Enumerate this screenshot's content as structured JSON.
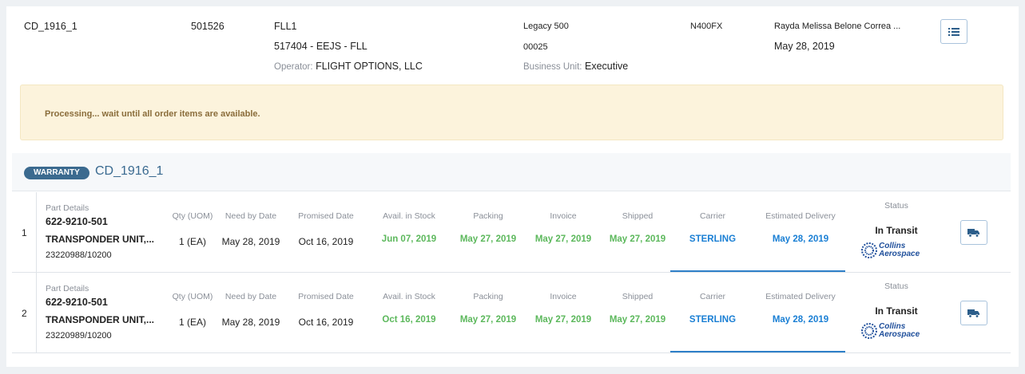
{
  "header": {
    "order_id": "CD_1916_1",
    "account_number": "501526",
    "location_code": "FLL1",
    "location_name": "517404 - EEJS - FLL",
    "operator_label": "Operator:",
    "operator_value": "FLIGHT OPTIONS, LLC",
    "aircraft_model": "Legacy 500",
    "serial": "00025",
    "business_unit_label": "Business Unit:",
    "business_unit_value": "Executive",
    "tail_number": "N400FX",
    "requester_name": "Rayda Melissa Belone Correa ...",
    "requester_date": "May 28, 2019",
    "menu_icon": "list-icon"
  },
  "alert": {
    "message": "Processing... wait until all order items are available."
  },
  "order": {
    "badge": "WARRANTY",
    "id": "CD_1916_1"
  },
  "columns": {
    "part_details": "Part Details",
    "qty": "Qty (UOM)",
    "need_by": "Need by Date",
    "promised": "Promised Date",
    "avail": "Avail. in Stock",
    "packing": "Packing",
    "invoice": "Invoice",
    "shipped": "Shipped",
    "carrier": "Carrier",
    "est_delivery": "Estimated Delivery",
    "status": "Status"
  },
  "items": [
    {
      "num": "1",
      "part_number": "622-9210-501",
      "description": "TRANSPONDER UNIT,...",
      "serial": "23220988/10200",
      "qty": "1 (EA)",
      "need_by": "May 28, 2019",
      "promised": "Oct 16, 2019",
      "avail": "Jun 07, 2019",
      "packing": "May 27, 2019",
      "invoice": "May 27, 2019",
      "shipped": "May 27, 2019",
      "carrier": "STERLING",
      "est_delivery": "May 28, 2019",
      "status": "In Transit",
      "logo_line1": "Collins",
      "logo_line2": "Aerospace"
    },
    {
      "num": "2",
      "part_number": "622-9210-501",
      "description": "TRANSPONDER UNIT,...",
      "serial": "23220989/10200",
      "qty": "1 (EA)",
      "need_by": "May 28, 2019",
      "promised": "Oct 16, 2019",
      "avail": "Oct 16, 2019",
      "packing": "May 27, 2019",
      "invoice": "May 27, 2019",
      "shipped": "May 27, 2019",
      "carrier": "STERLING",
      "est_delivery": "May 28, 2019",
      "status": "In Transit",
      "logo_line1": "Collins",
      "logo_line2": "Aerospace"
    }
  ],
  "colors": {
    "accent_blue": "#1a7fd4",
    "date_green": "#5cb85c",
    "badge_bg": "#3b6a8f",
    "alert_bg": "#fcf3dc"
  }
}
